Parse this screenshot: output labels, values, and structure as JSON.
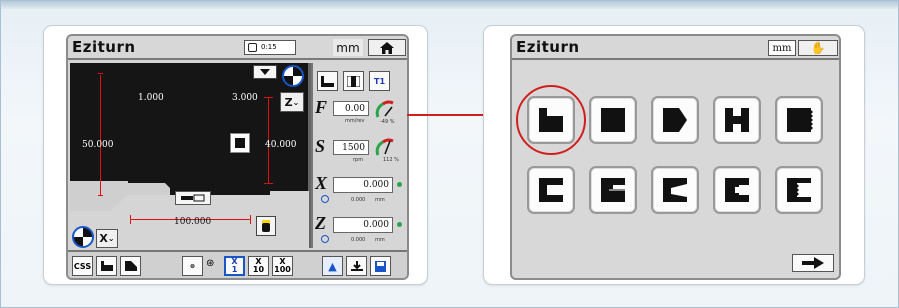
{
  "left_screen": {
    "brand": "Eziturn",
    "timer": "0:15",
    "unit_label": "mm",
    "home_icon": "home-icon",
    "dims": {
      "top_left": "1.000",
      "top_right": "3.000",
      "left_height": "50.000",
      "right_height": "40.000",
      "bottom_length": "100.000"
    },
    "axis_button": "X",
    "z_button": "Z",
    "feed": {
      "label": "F",
      "value": "0.00",
      "unit": "mm/rev",
      "gauge_percent": "-49 %"
    },
    "speed": {
      "label": "S",
      "value": "1500",
      "unit": "rpm",
      "gauge_percent": "112 %"
    },
    "x_axis": {
      "label": "X",
      "value": "0.000",
      "sub": "0.000",
      "sub_unit": "mm"
    },
    "z_axis": {
      "label": "Z",
      "value": "0.000",
      "sub": "0.000",
      "sub_unit": "mm"
    },
    "bottom": {
      "css_label": "CSS",
      "step_x1": "X",
      "step_1": "1",
      "step_x10": "X",
      "step_10": "10",
      "step_x100": "X",
      "step_100": "100"
    },
    "right_top_buttons": [
      "T1"
    ]
  },
  "right_screen": {
    "brand": "Eziturn",
    "unit_label": "mm",
    "hand_icon": "hand-icon",
    "shapes_row1": [
      "step-shape",
      "face-shape",
      "taper-shape",
      "groove-shape",
      "thread-shape"
    ],
    "shapes_row2": [
      "bore-shape",
      "bore-step-shape",
      "bore-taper-shape",
      "bore-groove-shape",
      "bore-thread-shape"
    ],
    "next_icon": "arrow-right-icon"
  },
  "colors": {
    "accent_red": "#d11f1f",
    "dark_panel": "#151515",
    "green_dot": "#2ba34a"
  }
}
